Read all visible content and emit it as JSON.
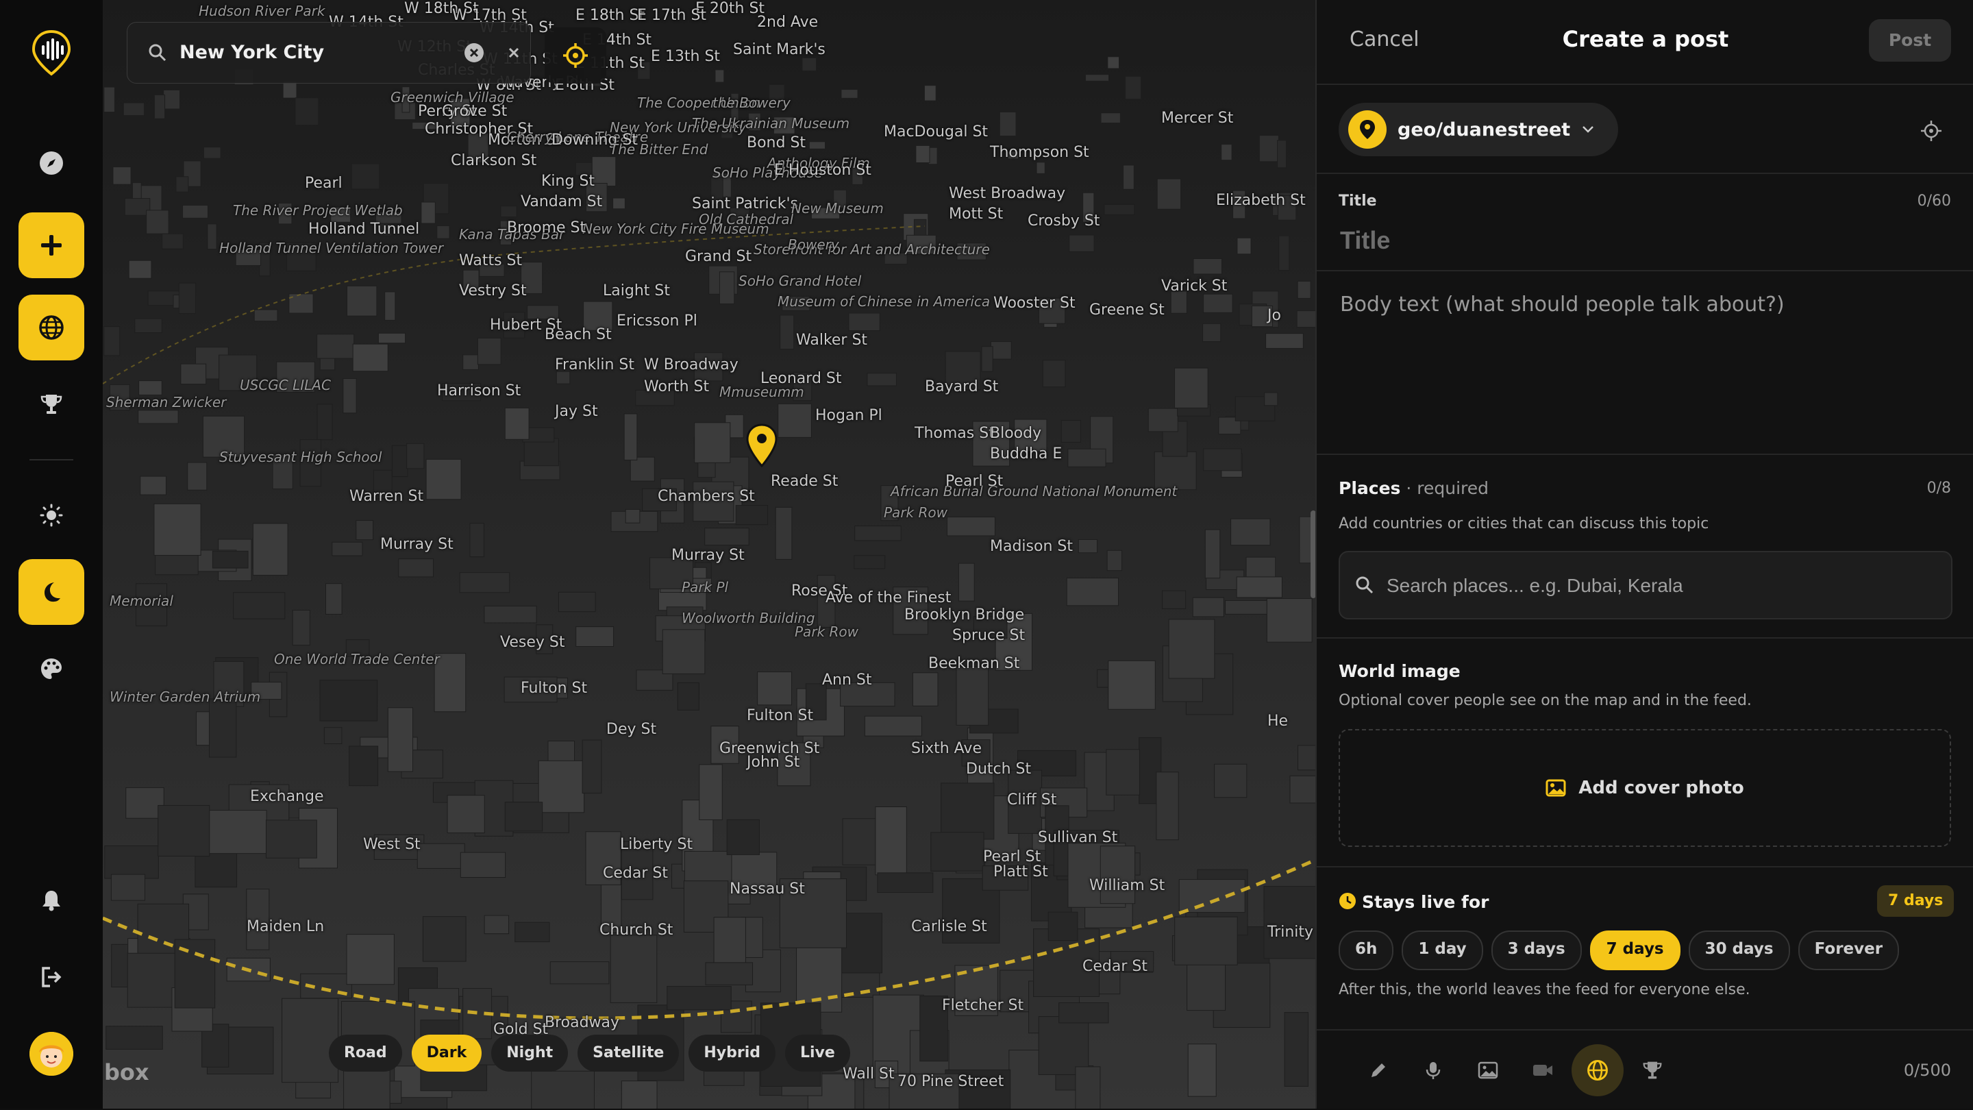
{
  "rail": {
    "items": [
      "logo-icon",
      "compass-icon",
      "plus-icon",
      "globe-icon",
      "trophy-icon",
      "sun-icon",
      "moon-icon",
      "palette-icon",
      "bell-icon",
      "logout-icon",
      "avatar"
    ]
  },
  "search": {
    "value": "New York City"
  },
  "map": {
    "labels": [
      "Hudson River Park",
      "W 14th St",
      "W 18th St",
      "W 17th St",
      "E 18th St",
      "E 20th St",
      "E 17th St",
      "2nd Ave",
      "W 12th St",
      "W 14th St",
      "W 11th St",
      "E 14th St",
      "E 11th St",
      "E 13th St",
      "Saint Mark's",
      "Charles St",
      "Greenwich Village",
      "W 8th St",
      "Waverly Pl",
      "E 8th St",
      "The Cooper Union",
      "the Bowery",
      "Perry St",
      "Grove St",
      "Christopher St",
      "New York University",
      "The Ukrainian Museum",
      "Morton St",
      "Clarkson St",
      "Cherry Lane Theatre",
      "Downing St",
      "The Bitter End",
      "Bond St",
      "Anthology Film",
      "King St",
      "Vandam St",
      "SoHo Playhouse",
      "E Houston St",
      "Saint Patrick's",
      "Old Cathedral",
      "The River Project Wetlab",
      "Holland Tunnel",
      "Kana Tapas Bar",
      "New York City Fire Museum",
      "Broome St",
      "New Museum",
      "Holland Tunnel Ventilation Tower",
      "Watts St",
      "Grand St",
      "SoHo Grand Hotel",
      "Storefront for Art and Architecture",
      "Bowery",
      "Vestry St",
      "Laight St",
      "Ericsson Pl",
      "Museum of Chinese in America",
      "Hubert St",
      "Beach St",
      "Walker St",
      "USCGC LILAC",
      "Franklin St",
      "Sherman Zwicker",
      "Harrison St",
      "Worth St",
      "Leonard St",
      "Mmuseumm",
      "Bayard St",
      "Jay St",
      "Thomas St",
      "Hogan Pl",
      "Stuyvesant High School",
      "Reade St",
      "African Burial Ground National Monument",
      "Bloody",
      "Buddha E",
      "Pearl St",
      "Warren St",
      "Chambers St",
      "Park Row",
      "Madison St",
      "Murray St",
      "Murray St",
      "Park Pl",
      "Rose St",
      "Ave of the Finest",
      "Brooklyn Bridge",
      "Memorial",
      "Woolworth Building",
      "Park Row",
      "Spruce St",
      "Vesey St",
      "Beekman St",
      "One World Trade Center",
      "Fulton St",
      "Ann St",
      "Fulton St",
      "Winter Garden Atrium",
      "Dey St",
      "John St",
      "Liberty St",
      "Cedar St",
      "Nassau St",
      "Platt St",
      "Cliff St",
      "Pearl St",
      "Maiden Ln",
      "Carlisle St",
      "Cedar St",
      "Fletcher St",
      "70 Pine Street",
      "Wall St",
      "Exchange",
      "West St",
      "Greenwich St",
      "Broadway",
      "Church St",
      "W Broadway",
      "Varick St",
      "Elizabeth St",
      "Mott St",
      "Crosby St",
      "Mercer St",
      "Greene St",
      "Wooster St",
      "West Broadway",
      "Thompson St",
      "MacDougal St",
      "Sullivan St",
      "Sixth Ave",
      "William St",
      "Dutch St",
      "Gold St",
      "Trinity Pl",
      "Jo",
      "He",
      "Pearl"
    ],
    "layers": [
      "Road",
      "Dark",
      "Night",
      "Satellite",
      "Hybrid",
      "Live"
    ],
    "active_layer": "Dark",
    "attribution": "box"
  },
  "panel": {
    "cancel": "Cancel",
    "title": "Create a post",
    "post": "Post",
    "community": "geo/duanestreet",
    "title_label": "Title",
    "title_count": "0/60",
    "title_placeholder": "Title",
    "body_placeholder": "Body text (what should people talk about?)",
    "places_label": "Places",
    "places_required": "· required",
    "places_count": "0/8",
    "places_help": "Add countries or cities that can discuss this topic",
    "places_placeholder": "Search places... e.g. Dubai, Kerala",
    "world_image_title": "World image",
    "world_image_help": "Optional cover people see on the map and in the feed.",
    "add_cover": "Add cover photo",
    "stays_title": "Stays live for",
    "stays_badge": "7 days",
    "durations": [
      "6h",
      "1 day",
      "3 days",
      "7 days",
      "30 days",
      "Forever"
    ],
    "active_duration": "7 days",
    "stays_help": "After this, the world leaves the feed for everyone else.",
    "char_count": "0/500"
  },
  "colors": {
    "accent": "#f5c518",
    "panel_bg": "#121212",
    "rail_bg": "#0c0c0c",
    "map_bg": "#2c2c2c"
  }
}
